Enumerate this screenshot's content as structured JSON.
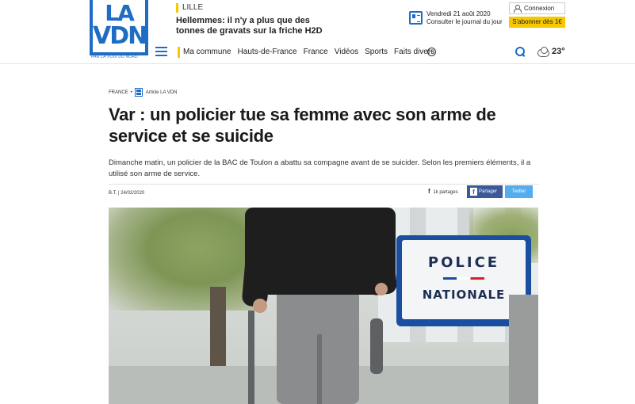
{
  "brand": {
    "logo_line1": "LA",
    "logo_line2": "VDN",
    "logo_sub": "PAR LA VOIX DU NORD",
    "accent": "#1d6dc4",
    "yellow": "#f5c800"
  },
  "breaking": {
    "tag": "LILLE",
    "title": "Hellemmes: il n'y a plus que des tonnes de gravats sur la friche H2D"
  },
  "journal": {
    "date": "Vendredi 21 août 2020",
    "link": "Consulter le journal du jour"
  },
  "account": {
    "connexion": "Connexion",
    "abonner": "S'abonner dès 1€"
  },
  "nav": {
    "items": [
      "Ma commune",
      "Hauts-de-France",
      "France",
      "Vidéos",
      "Sports",
      "Faits divers"
    ],
    "plus": "+",
    "temperature": "23°"
  },
  "article": {
    "crumb_section": "FRANCE",
    "crumb_sep": "•",
    "crumb_type": "Article LA VDN",
    "title": "Var : un policier tue sa femme avec son arme de service et se suicide",
    "lead": "Dimanche matin, un policier de la BAC de Toulon a abattu sa compagne avant de se suicider. Selon les premiers éléments, il a utilisé son arme de service.",
    "meta": "B.T. |  24/02/2020",
    "shares_icon": "f",
    "shares": "1k partages",
    "fb_icon": "f",
    "fb_label": "Partager",
    "tw_label": "Twitter"
  },
  "photo": {
    "sign_line1": "POLICE",
    "sign_line2": "NATIONALE"
  }
}
